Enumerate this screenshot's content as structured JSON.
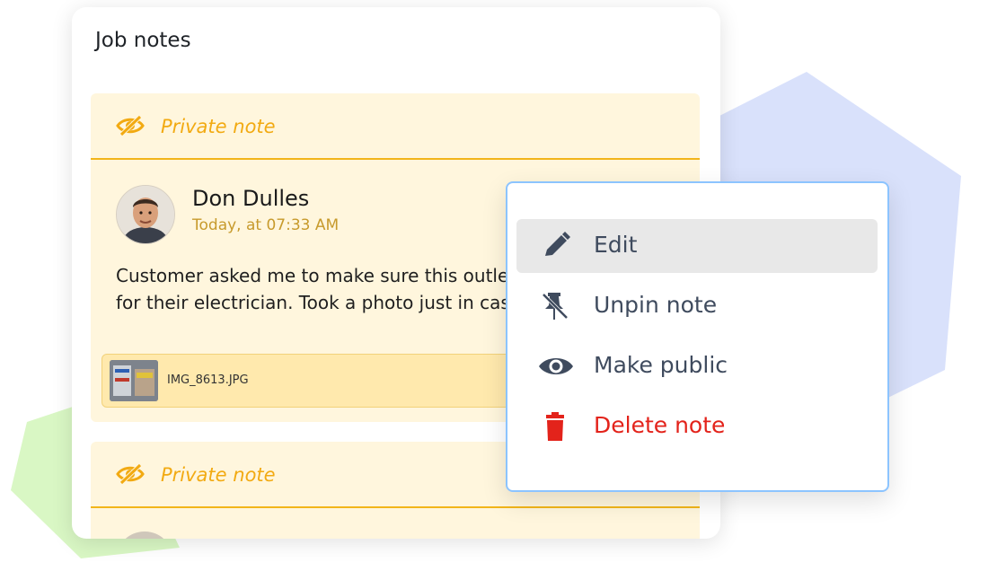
{
  "colors": {
    "accent_yellow": "#f2aa12",
    "note_bg": "#fff6dd",
    "danger": "#e3231b",
    "menu_border": "#8cc4ff"
  },
  "card": {
    "title": "Job notes"
  },
  "notes": [
    {
      "badge": "Private note",
      "badge_icon": "eye-slash-icon",
      "author": "Don Dulles",
      "time": "Today, at 07:33 AM",
      "body_lines": [
        "Customer asked me to make sure this outlet",
        "for their electrician. Took a photo just in cas"
      ],
      "attachment": {
        "filename": "IMG_8613.JPG"
      }
    },
    {
      "badge": "Private note",
      "badge_icon": "eye-slash-icon"
    }
  ],
  "menu": {
    "items": [
      {
        "label": "Edit",
        "icon": "pencil-icon"
      },
      {
        "label": "Unpin note",
        "icon": "pin-off-icon"
      },
      {
        "label": "Make public",
        "icon": "eye-icon"
      },
      {
        "label": "Delete note",
        "icon": "trash-icon"
      }
    ]
  }
}
